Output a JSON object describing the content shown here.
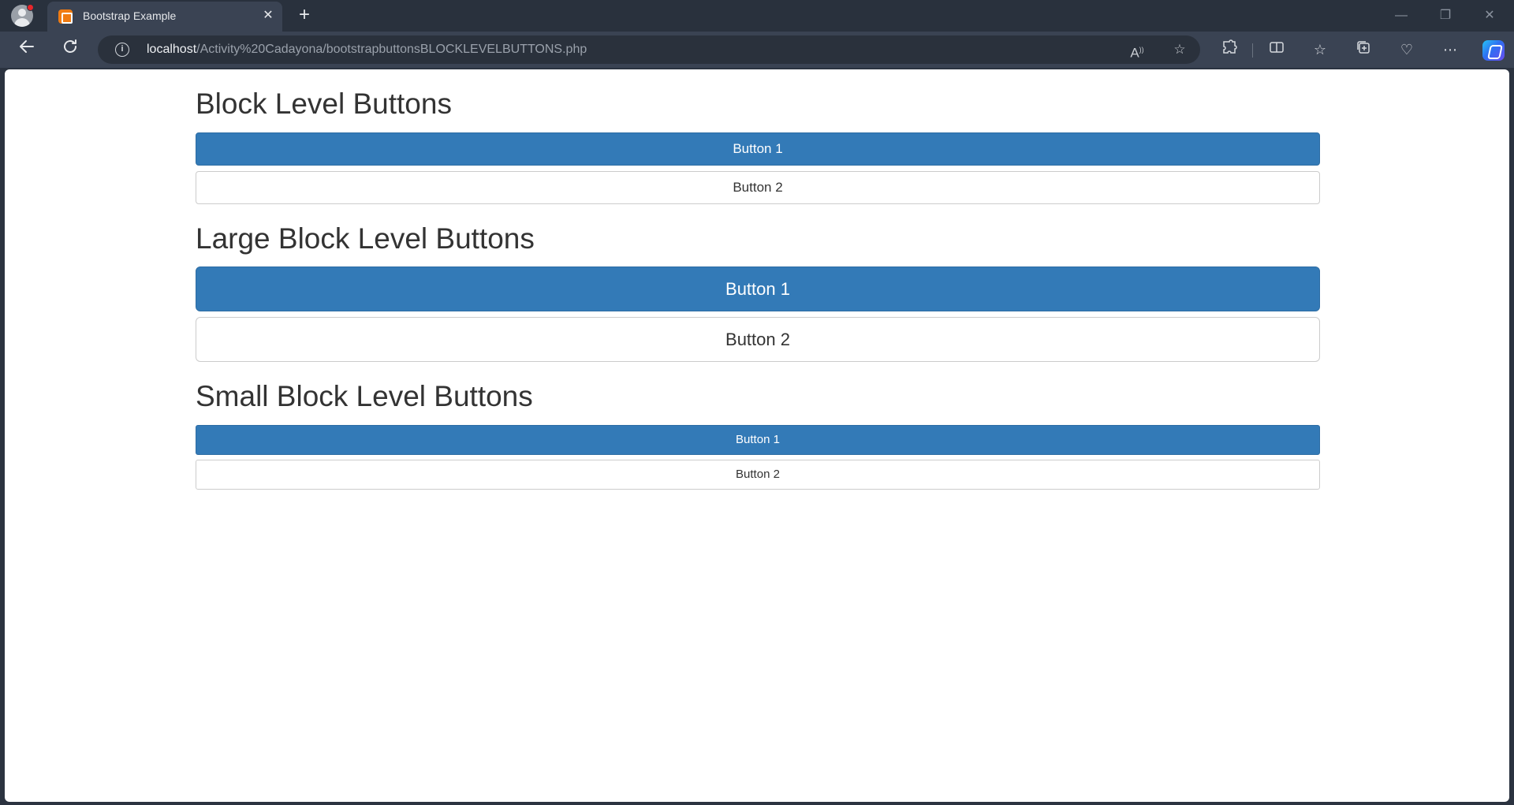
{
  "browser": {
    "tab_title": "Bootstrap Example",
    "tab_close": "✕",
    "new_tab": "+",
    "url_host": "localhost",
    "url_path": "/Activity%20Cadayona/bootstrapbuttonsBLOCKLEVELBUTTONS.php",
    "icons": [
      "profile-avatar",
      "xampp-favicon",
      "back-arrow",
      "refresh",
      "site-info",
      "read-aloud",
      "favorite-star",
      "extensions",
      "split-screen",
      "favorites",
      "collections",
      "browser-essentials",
      "more",
      "copilot"
    ],
    "window_controls": {
      "minimize": "—",
      "restore": "❐",
      "close": "✕"
    },
    "colors": {
      "titlebar": "#29313d",
      "toolbar": "#3a4353",
      "address": "#2a313c"
    }
  },
  "page": {
    "sections": [
      {
        "title": "Block Level Buttons",
        "button1": "Button 1",
        "button2": "Button 2"
      },
      {
        "title": "Large Block Level Buttons",
        "button1": "Button 1",
        "button2": "Button 2"
      },
      {
        "title": "Small Block Level Buttons",
        "button1": "Button 1",
        "button2": "Button 2"
      }
    ],
    "colors": {
      "primary": "#337ab7",
      "default": "#ffffff",
      "heading": "#333333"
    }
  }
}
